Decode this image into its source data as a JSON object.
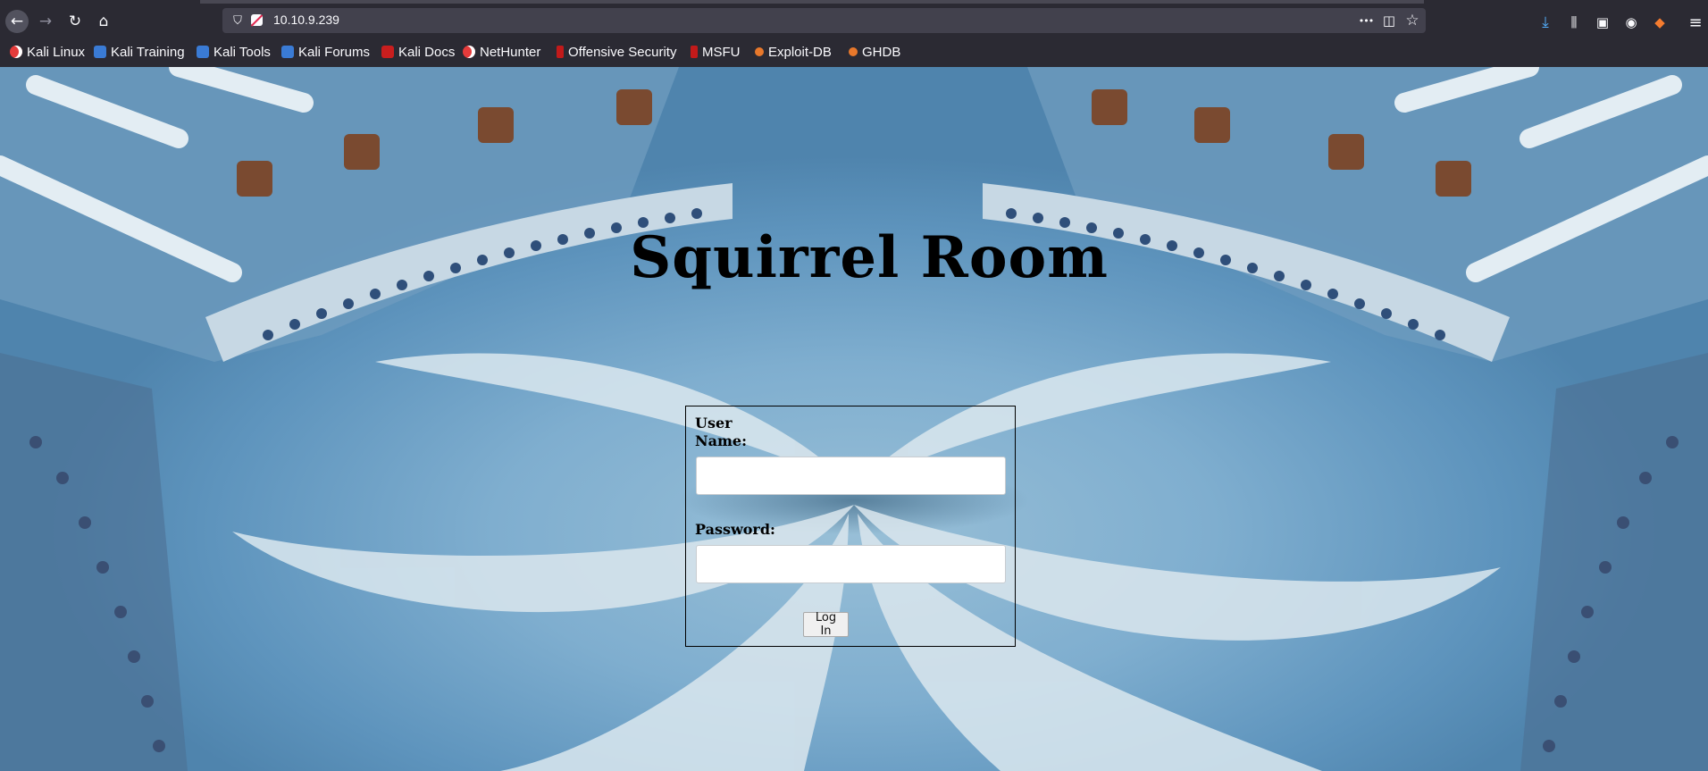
{
  "browser": {
    "url": "10.10.9.239",
    "icons": {
      "back": "back-arrow-icon",
      "forward": "forward-arrow-icon",
      "reload": "reload-icon",
      "home": "home-icon",
      "tracking": "shield-icon",
      "insecure": "insecure-lock-icon",
      "more": "more-actions-icon",
      "pocket": "pocket-icon",
      "bookmark": "star-icon",
      "downloads": "download-arrow-icon",
      "library": "library-icon",
      "sidebar": "sidebar-icon",
      "account": "account-icon",
      "extension": "fox-extension-icon",
      "menu": "hamburger-menu-icon"
    },
    "glyphs": {
      "back": "←",
      "forward": "→",
      "reload": "↻",
      "home": "⌂",
      "shield": "⛉",
      "more": "•••",
      "pocket": "◫",
      "star": "☆",
      "download": "⤓",
      "library": "⫼",
      "sidebar": "▣",
      "account": "◉",
      "extension": "◆",
      "menu": "≡"
    },
    "bookmarks": [
      {
        "label": "Kali Linux",
        "icon": "kali-dragon-icon"
      },
      {
        "label": "Kali Training",
        "icon": "kali-training-icon"
      },
      {
        "label": "Kali Tools",
        "icon": "kali-tools-icon"
      },
      {
        "label": "Kali Forums",
        "icon": "kali-forums-icon"
      },
      {
        "label": "Kali Docs",
        "icon": "kali-docs-icon"
      },
      {
        "label": "NetHunter",
        "icon": "nethunter-icon"
      },
      {
        "label": "Offensive Security",
        "icon": "offsec-icon"
      },
      {
        "label": "MSFU",
        "icon": "msfu-icon"
      },
      {
        "label": "Exploit-DB",
        "icon": "exploit-db-icon"
      },
      {
        "label": "GHDB",
        "icon": "ghdb-icon"
      }
    ]
  },
  "page": {
    "title": "Squirrel Room",
    "form": {
      "username_label": "User Name:",
      "username_value": "",
      "password_label": "Password:",
      "password_value": "",
      "submit_label": "Log In"
    }
  },
  "colors": {
    "chrome": "#2b2a33",
    "urlbar": "#42414d",
    "download_accent": "#54b0ff"
  }
}
